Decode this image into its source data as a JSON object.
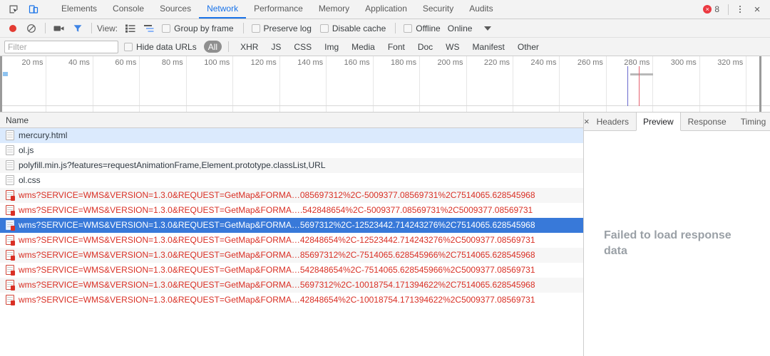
{
  "tabbar": {
    "inspect_icon": "inspect-cursor-icon",
    "device_icon": "device-toggle-icon",
    "tabs": [
      {
        "label": "Elements",
        "active": false
      },
      {
        "label": "Console",
        "active": false
      },
      {
        "label": "Sources",
        "active": false
      },
      {
        "label": "Network",
        "active": true
      },
      {
        "label": "Performance",
        "active": false
      },
      {
        "label": "Memory",
        "active": false
      },
      {
        "label": "Application",
        "active": false
      },
      {
        "label": "Security",
        "active": false
      },
      {
        "label": "Audits",
        "active": false
      }
    ],
    "error_count": "8",
    "error_glyph": "×",
    "menu_icon": "kebab-menu-icon",
    "close_icon": "×",
    "accent_color": "#1a73e8",
    "error_color": "#eb3941"
  },
  "toolbar": {
    "record_icon": "record-button-icon",
    "clear_icon": "clear-icon",
    "capture_screenshots_icon": "camera-icon",
    "filter_icon": "funnel-icon",
    "view_label": "View:",
    "view_list_icon": "list-view-icon",
    "view_waterfall_icon": "waterfall-view-icon",
    "group_by_frame": "Group by frame",
    "preserve_log": "Preserve log",
    "disable_cache": "Disable cache",
    "offline": "Offline",
    "throttling_value": "Online"
  },
  "filterbar": {
    "placeholder": "Filter",
    "value": "",
    "hide_data_urls": "Hide data URLs",
    "types": [
      {
        "label": "All",
        "active": true
      },
      {
        "label": "XHR",
        "active": false
      },
      {
        "label": "JS",
        "active": false
      },
      {
        "label": "CSS",
        "active": false
      },
      {
        "label": "Img",
        "active": false
      },
      {
        "label": "Media",
        "active": false
      },
      {
        "label": "Font",
        "active": false
      },
      {
        "label": "Doc",
        "active": false
      },
      {
        "label": "WS",
        "active": false
      },
      {
        "label": "Manifest",
        "active": false
      },
      {
        "label": "Other",
        "active": false
      }
    ]
  },
  "overview": {
    "ticks": [
      "20 ms",
      "40 ms",
      "60 ms",
      "80 ms",
      "100 ms",
      "120 ms",
      "140 ms",
      "160 ms",
      "180 ms",
      "200 ms",
      "220 ms",
      "240 ms",
      "260 ms",
      "280 ms",
      "300 ms",
      "320 ms"
    ],
    "dom_content_loaded_color": "#6a6acd",
    "load_event_color": "#e6626f",
    "dom_content_loaded_ms": 277,
    "load_event_ms": 283
  },
  "requests": {
    "column_name": "Name",
    "rows": [
      {
        "name": "mercury.html",
        "failed": false,
        "state": "hovered"
      },
      {
        "name": "ol.js",
        "failed": false,
        "state": "normal"
      },
      {
        "name": "polyfill.min.js?features=requestAnimationFrame,Element.prototype.classList,URL",
        "failed": false,
        "state": "alt"
      },
      {
        "name": "ol.css",
        "failed": false,
        "state": "normal"
      },
      {
        "name": "wms?SERVICE=WMS&VERSION=1.3.0&REQUEST=GetMap&FORMA…085697312%2C-5009377.08569731%2C7514065.628545968",
        "failed": true,
        "state": "alt"
      },
      {
        "name": "wms?SERVICE=WMS&VERSION=1.3.0&REQUEST=GetMap&FORMA….542848654%2C-5009377.08569731%2C5009377.08569731",
        "failed": true,
        "state": "normal"
      },
      {
        "name": "wms?SERVICE=WMS&VERSION=1.3.0&REQUEST=GetMap&FORMA…5697312%2C-12523442.714243276%2C7514065.628545968",
        "failed": true,
        "state": "selected"
      },
      {
        "name": "wms?SERVICE=WMS&VERSION=1.3.0&REQUEST=GetMap&FORMA…42848654%2C-12523442.714243276%2C5009377.08569731",
        "failed": true,
        "state": "normal"
      },
      {
        "name": "wms?SERVICE=WMS&VERSION=1.3.0&REQUEST=GetMap&FORMA…85697312%2C-7514065.628545966%2C7514065.628545968",
        "failed": true,
        "state": "alt"
      },
      {
        "name": "wms?SERVICE=WMS&VERSION=1.3.0&REQUEST=GetMap&FORMA…542848654%2C-7514065.628545966%2C5009377.08569731",
        "failed": true,
        "state": "normal"
      },
      {
        "name": "wms?SERVICE=WMS&VERSION=1.3.0&REQUEST=GetMap&FORMA…5697312%2C-10018754.171394622%2C7514065.628545968",
        "failed": true,
        "state": "alt"
      },
      {
        "name": "wms?SERVICE=WMS&VERSION=1.3.0&REQUEST=GetMap&FORMA…42848654%2C-10018754.171394622%2C5009377.08569731",
        "failed": true,
        "state": "normal"
      }
    ]
  },
  "detail": {
    "close_glyph": "×",
    "tabs": [
      {
        "label": "Headers",
        "active": false
      },
      {
        "label": "Preview",
        "active": true
      },
      {
        "label": "Response",
        "active": false
      },
      {
        "label": "Timing",
        "active": false
      }
    ],
    "empty_message": "Failed to load response data"
  }
}
